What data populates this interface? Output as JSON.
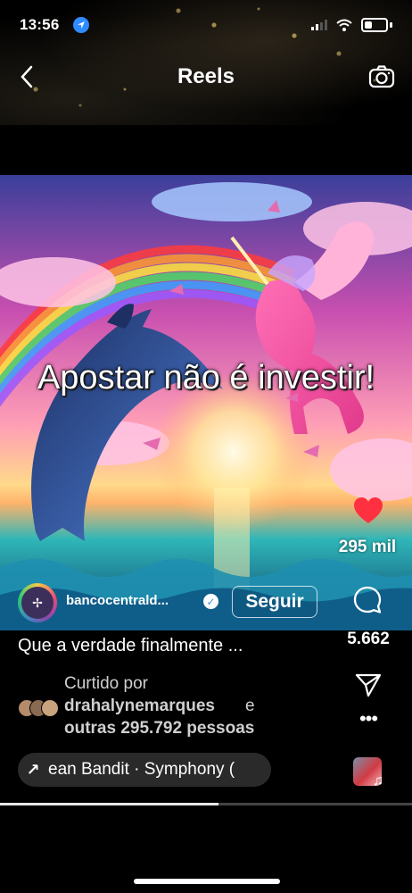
{
  "status_bar": {
    "time": "13:56",
    "location_icon": "location-arrow-icon",
    "signal_icon": "cellular-signal-icon",
    "wifi_icon": "wifi-icon",
    "battery_icon": "battery-icon"
  },
  "nav": {
    "title": "Reels",
    "back_icon": "chevron-left-icon",
    "camera_icon": "camera-icon"
  },
  "video": {
    "overlay_text": "Apostar não é investir!"
  },
  "actions": {
    "like_icon": "heart-icon",
    "like_color": "#ff3040",
    "likes": "295 mil",
    "comment_icon": "comment-bubble-icon",
    "comments": "5.662",
    "share_icon": "paper-plane-icon",
    "more_icon": "more-dots-icon",
    "audio_icon": "music-note-icon"
  },
  "account": {
    "avatar_text": "✢",
    "username": "bancocentrald...",
    "verified_icon": "verified-badge-icon",
    "follow_label": "Seguir"
  },
  "caption": "Que a verdade finalmente ...",
  "liked_by": {
    "label": "Curtido por",
    "user": "drahalynemarques",
    "and": "e",
    "others": "outras 295.792 pessoas"
  },
  "audio": {
    "arrow_icon": "arrow-up-right-icon",
    "label": "ean Bandit · Symphony ("
  },
  "progress": 0.53
}
